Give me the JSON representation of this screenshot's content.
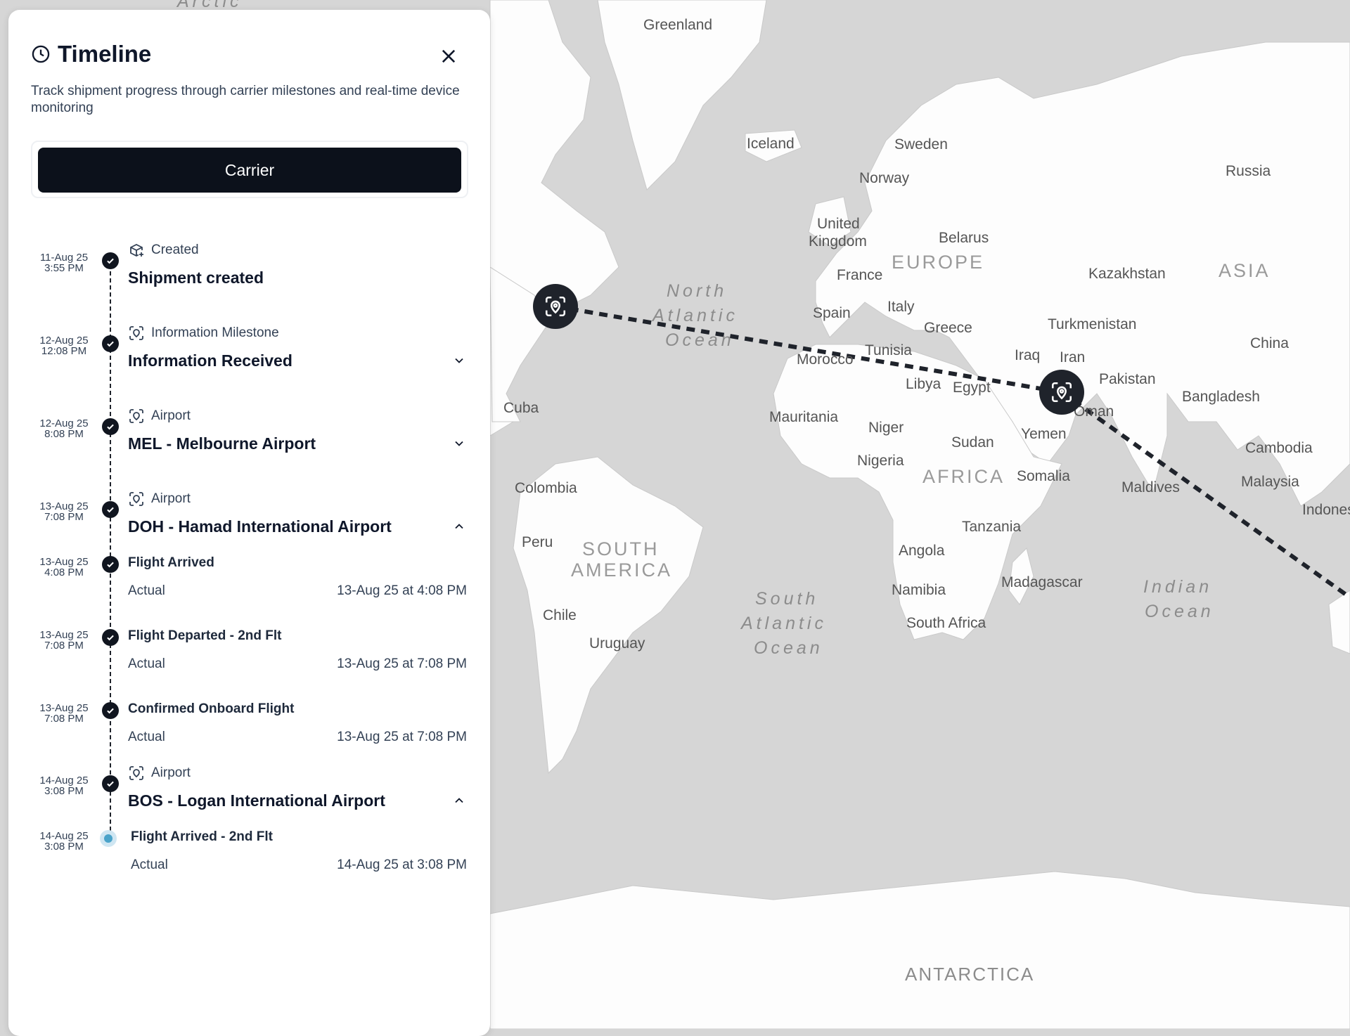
{
  "panel": {
    "title": "Timeline",
    "description": "Track shipment progress through carrier milestones and real-time device monitoring",
    "tab_label": "Carrier"
  },
  "timeline": [
    {
      "date": "11-Aug 25",
      "time": "3:55 PM",
      "category": "Created",
      "name": "Shipment created"
    },
    {
      "date": "12-Aug 25",
      "time": "12:08 PM",
      "category": "Information Milestone",
      "name": "Information Received",
      "expanded": false
    },
    {
      "date": "12-Aug 25",
      "time": "8:08 PM",
      "category": "Airport",
      "name": "MEL - Melbourne Airport",
      "expanded": false
    },
    {
      "date": "13-Aug 25",
      "time": "7:08 PM",
      "category": "Airport",
      "name": "DOH - Hamad International Airport",
      "expanded": true
    },
    {
      "date": "13-Aug 25",
      "time": "4:08 PM",
      "event": "Flight Arrived",
      "actual_label": "Actual",
      "actual_value": "13-Aug 25 at 4:08 PM"
    },
    {
      "date": "13-Aug 25",
      "time": "7:08 PM",
      "event": "Flight Departed - 2nd Flt",
      "actual_label": "Actual",
      "actual_value": "13-Aug 25 at 7:08 PM"
    },
    {
      "date": "13-Aug 25",
      "time": "7:08 PM",
      "event": "Confirmed Onboard Flight",
      "actual_label": "Actual",
      "actual_value": "13-Aug 25 at 7:08 PM"
    },
    {
      "date": "14-Aug 25",
      "time": "3:08 PM",
      "category": "Airport",
      "name": "BOS - Logan International Airport",
      "expanded": true
    },
    {
      "date": "14-Aug 25",
      "time": "3:08 PM",
      "event": "Flight Arrived - 2nd Flt",
      "actual_label": "Actual",
      "actual_value": "14-Aug 25 at 3:08 PM",
      "current": true
    }
  ],
  "map": {
    "labels": {
      "greenland": "Greenland",
      "iceland": "Iceland",
      "sweden": "Sweden",
      "norway": "Norway",
      "russia": "Russia",
      "united": "United",
      "kingdom": "Kingdom",
      "belarus": "Belarus",
      "europe": "EUROPE",
      "france": "France",
      "kazakhstan": "Kazakhstan",
      "asia": "ASIA",
      "spain": "Spain",
      "italy": "Italy",
      "greece": "Greece",
      "turkmenistan": "Turkmenistan",
      "north": "North",
      "atlantic": "Atlantic",
      "ocean": "Ocean",
      "morocco": "Morocco",
      "tunisia": "Tunisia",
      "iraq": "Iraq",
      "iran": "Iran",
      "china": "China",
      "pakistan": "Pakistan",
      "libya": "Libya",
      "egypt": "Egypt",
      "bangladesh": "Bangladesh",
      "cuba": "Cuba",
      "mauritania": "Mauritania",
      "niger": "Niger",
      "oman": "Oman",
      "yemen": "Yemen",
      "sudan": "Sudan",
      "cambodia": "Cambodia",
      "nigeria": "Nigeria",
      "africa": "AFRICA",
      "somalia": "Somalia",
      "colombia": "Colombia",
      "maldives": "Maldives",
      "malaysia": "Malaysia",
      "indonesia": "Indones",
      "tanzania": "Tanzania",
      "peru": "Peru",
      "south_word": "SOUTH",
      "america": "AMERICA",
      "angola": "Angola",
      "madagascar": "Madagascar",
      "namibia": "Namibia",
      "chile": "Chile",
      "south": "South",
      "indian": "Indian",
      "south_africa": "South Africa",
      "uruguay": "Uruguay",
      "antarctica": "ANTARCTICA",
      "arctic": "Arctic"
    }
  }
}
